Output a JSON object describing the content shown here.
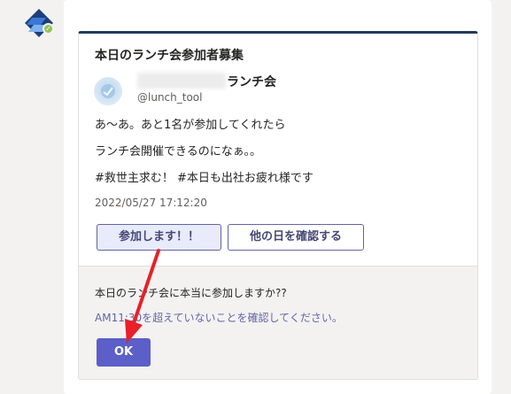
{
  "card": {
    "title": "本日のランチ会参加者募集",
    "author": {
      "name_suffix": "ランチ会",
      "handle": "@lunch_tool"
    },
    "body_lines": [
      "あ～あ。あと1名が参加してくれたら",
      "ランチ会開催できるのになぁ。。",
      "#救世主求む！ #本日も出社お疲れ様です"
    ],
    "timestamp": "2022/05/27 17:12:20",
    "actions": {
      "join_label": "参加します！！",
      "other_day_label": "他の日を確認する"
    },
    "confirm": {
      "question": "本日のランチ会に本当に参加しますか??",
      "note": "AM11:30を超えていないことを確認してください。",
      "ok_label": "OK"
    }
  },
  "colors": {
    "accent": "#5b5fc7",
    "link": "#6264a7",
    "card_top_border": "#243a5e",
    "annotation_arrow": "#e8202a"
  },
  "icons": {
    "bot_avatar": "power-automate-logo",
    "bot_status": "available-check-icon",
    "author_avatar": "blurred-profile-avatar"
  }
}
